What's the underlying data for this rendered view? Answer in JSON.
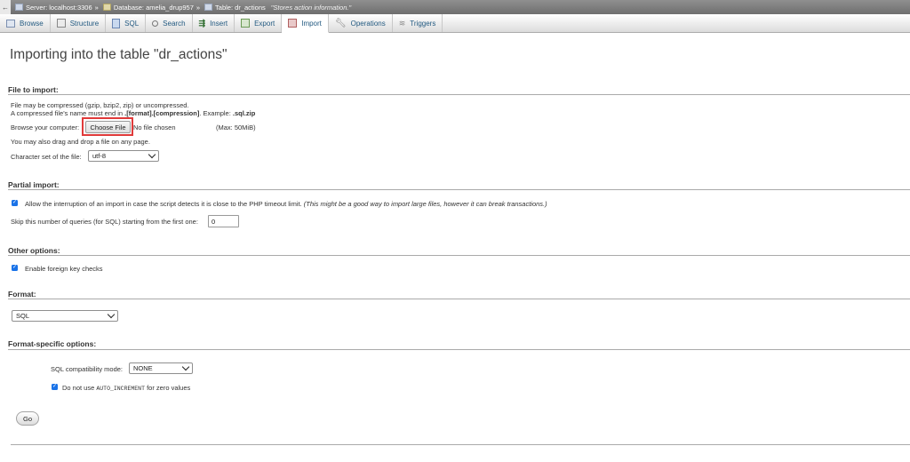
{
  "breadcrumb": {
    "server": "Server: localhost:3306",
    "database": "Database: amelia_drup957",
    "table": "Table: dr_actions",
    "comment": "\"Stores action information.\"",
    "separator": "»"
  },
  "tabs": [
    {
      "label": "Browse",
      "icon": "browse-icon"
    },
    {
      "label": "Structure",
      "icon": "structure-icon"
    },
    {
      "label": "SQL",
      "icon": "sql-icon"
    },
    {
      "label": "Search",
      "icon": "search-icon"
    },
    {
      "label": "Insert",
      "icon": "insert-icon"
    },
    {
      "label": "Export",
      "icon": "export-icon"
    },
    {
      "label": "Import",
      "icon": "import-icon",
      "active": true
    },
    {
      "label": "Operations",
      "icon": "operations-icon"
    },
    {
      "label": "Triggers",
      "icon": "triggers-icon"
    }
  ],
  "page": {
    "title": "Importing into the table \"dr_actions\""
  },
  "file_import": {
    "legend": "File to import:",
    "compressed_note": "File may be compressed (gzip, bzip2, zip) or uncompressed.",
    "name_note_prefix": "A compressed file's name must end in",
    "name_note_format": ".[format].[compression]",
    "name_note_example": ". Example:",
    "name_note_ext": ".sql.zip",
    "browse_label": "Browse your computer:",
    "choose_file_label": "Choose File",
    "no_file_text": "No file chosen",
    "max_size": "(Max: 50MiB)",
    "drag_note": "You may also drag and drop a file on any page.",
    "charset_label": "Character set of the file:",
    "charset_value": "utf-8"
  },
  "partial_import": {
    "legend": "Partial import:",
    "allow_interrupt_label": "Allow the interruption of an import in case the script detects it is close to the PHP timeout limit.",
    "allow_interrupt_note": "(This might be a good way to import large files, however it can break transactions.)",
    "skip_label": "Skip this number of queries (for SQL) starting from the first one:",
    "skip_value": "0"
  },
  "other_options": {
    "legend": "Other options:",
    "foreign_key_label": "Enable foreign key checks"
  },
  "format": {
    "legend": "Format:",
    "value": "SQL"
  },
  "format_specific": {
    "legend": "Format-specific options:",
    "compat_label": "SQL compatibility mode:",
    "compat_value": "NONE",
    "auto_increment_prefix": "Do not use",
    "auto_increment_code": "AUTO_INCREMENT",
    "auto_increment_suffix": "for zero values"
  },
  "actions": {
    "go_label": "Go"
  },
  "colors": {
    "accent_link": "#235a81",
    "highlight": "#e03a3a",
    "checkbox": "#1a73e8"
  }
}
